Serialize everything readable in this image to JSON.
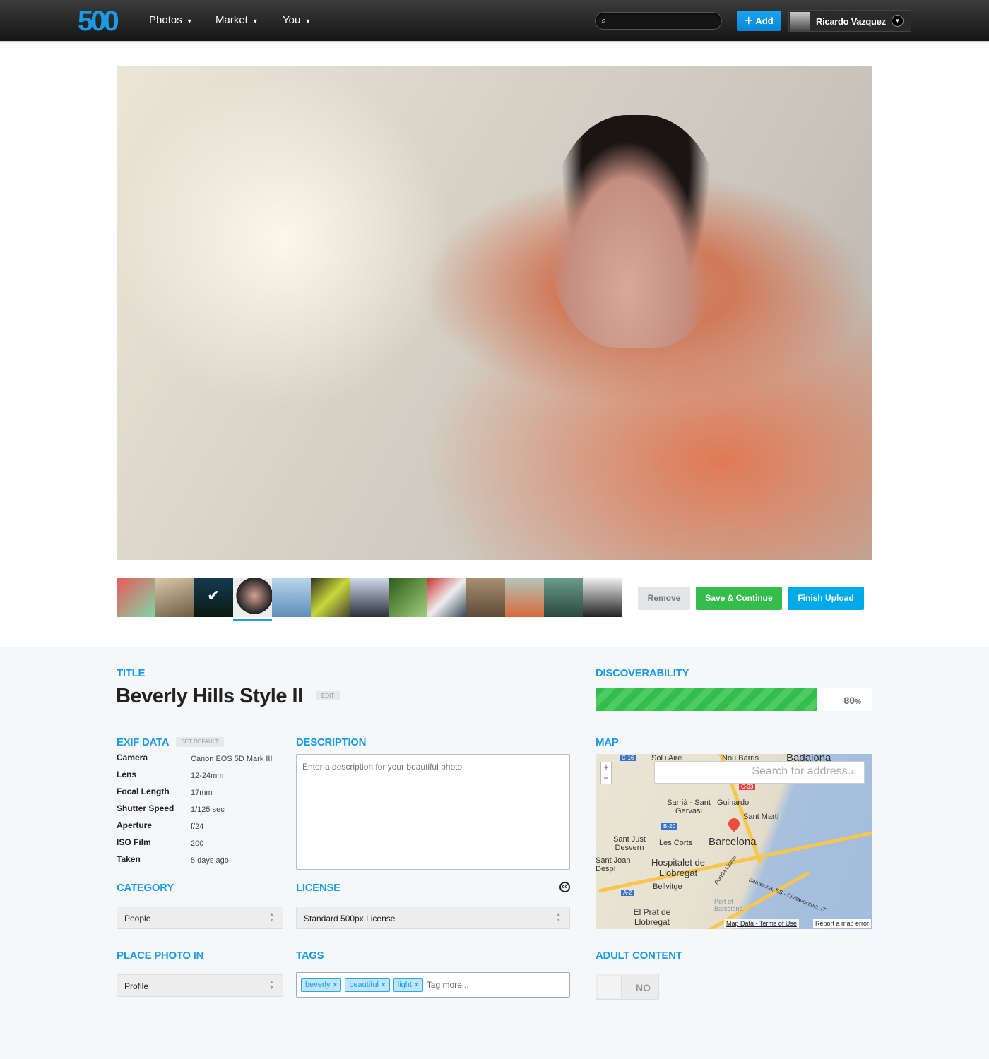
{
  "header": {
    "logo": "500",
    "nav": [
      "Photos",
      "Market",
      "You"
    ],
    "search_placeholder": "",
    "add_label": "Add",
    "user_name": "Ricardo Vazquez"
  },
  "photo": {
    "selected_index": 3,
    "thumbnail_count": 13,
    "checked_index": 2
  },
  "actions": {
    "remove": "Remove",
    "save": "Save & Continue",
    "finish": "Finish Upload"
  },
  "colors": {
    "accent": "#1a9be6",
    "green": "#33bd4a",
    "finish": "#00aae8"
  },
  "title": {
    "label": "TITLE",
    "value": "Beverly Hills Style II",
    "edit": "EDIT"
  },
  "discoverability": {
    "label": "DISCOVERABILITY",
    "percent": 80,
    "value_text": "80",
    "unit": "%"
  },
  "exif": {
    "label": "EXIF DATA",
    "set_default": "SET DEFAULT",
    "rows": [
      {
        "k": "Camera",
        "v": "Canon EOS 5D Mark III"
      },
      {
        "k": "Lens",
        "v": "12-24mm"
      },
      {
        "k": "Focal Length",
        "v": "17mm"
      },
      {
        "k": "Shutter Speed",
        "v": "1/125 sec"
      },
      {
        "k": "Aperture",
        "v": "f/24"
      },
      {
        "k": "ISO Film",
        "v": "200"
      },
      {
        "k": "Taken",
        "v": "5 days ago"
      }
    ]
  },
  "description": {
    "label": "DESCRIPTION",
    "placeholder": "Enter a description for your beautiful photo"
  },
  "map": {
    "label": "MAP",
    "search_placeholder": "Search for address...",
    "places": [
      "Sol i Aire",
      "Nou Barris",
      "Badalona",
      "Sarrià - Sant Gervasi",
      "Guinardo",
      "Sant Martí",
      "Barcelona",
      "Sant Just Desvern",
      "Les Corts",
      "Sant Joan Despí",
      "Hospitalet de Llobregat",
      "Bellvitge",
      "El Prat de Llobregat",
      "Port of Barcelona",
      "Barcelona, ES - Civitavecchia, IT",
      "Ronda Litoral"
    ],
    "roads": [
      "C-16",
      "C-33",
      "B-20",
      "A-2"
    ],
    "map_data": "Map Data",
    "terms": "Terms of Use",
    "report": "Report a map error"
  },
  "category": {
    "label": "CATEGORY",
    "value": "People"
  },
  "license": {
    "label": "LICENSE",
    "value": "Standard 500px License",
    "icon": "cc-icon"
  },
  "place": {
    "label": "PLACE PHOTO IN",
    "value": "Profile"
  },
  "tags": {
    "label": "TAGS",
    "items": [
      "beverly",
      "beautiful",
      "light"
    ],
    "placeholder": "Tag more..."
  },
  "adult": {
    "label": "ADULT CONTENT",
    "value": "NO"
  }
}
